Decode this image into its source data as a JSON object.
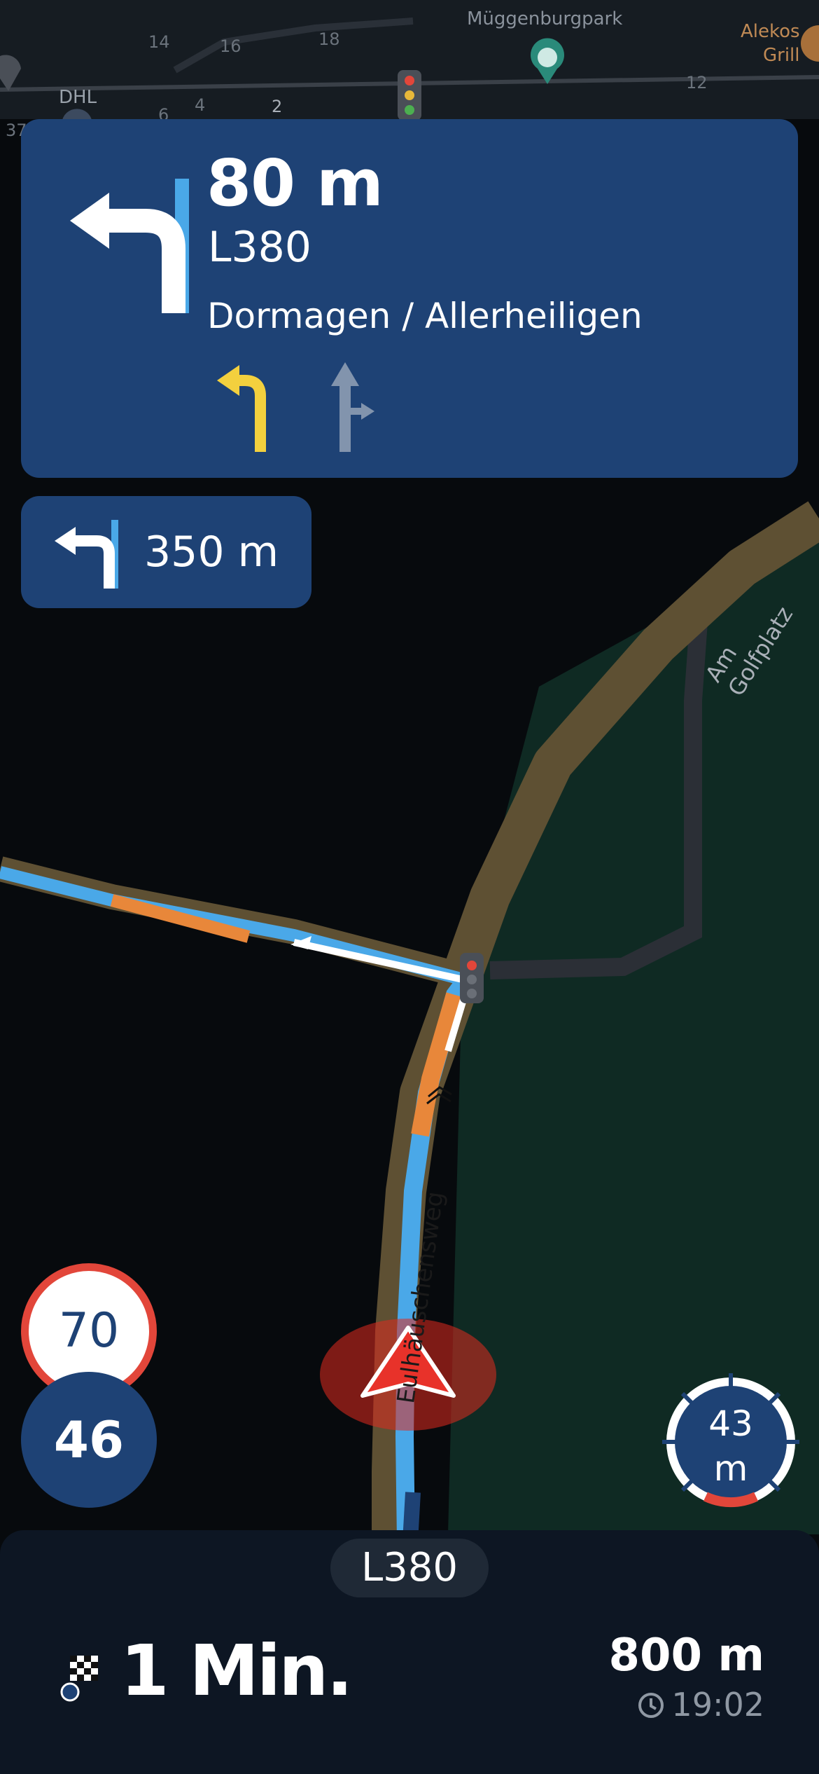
{
  "map": {
    "poi_park": "Müggenburgpark",
    "poi_restaurant_line1": "Alekos",
    "poi_restaurant_line2": "Grill",
    "poi_dhl": "DHL",
    "street_golfplatz": "Am Golfplatz",
    "street_current": "Eulhäuschensweg",
    "house_numbers": [
      "14",
      "16",
      "18",
      "4",
      "2",
      "6",
      "12",
      "37"
    ]
  },
  "maneuver": {
    "distance": "80 m",
    "road": "L380",
    "direction": "Dormagen / Allerheiligen",
    "arrow_icon": "turn-left-icon",
    "lanes": [
      {
        "icon": "lane-left-icon",
        "active": true
      },
      {
        "icon": "lane-straight-right-icon",
        "active": false
      }
    ]
  },
  "next_maneuver": {
    "distance": "350 m",
    "icon": "turn-left-icon"
  },
  "speed": {
    "limit": "70",
    "current": "46"
  },
  "gps_accuracy": {
    "value": "43",
    "unit": "m"
  },
  "bottom": {
    "current_road": "L380",
    "eta_duration": "1 Min.",
    "remaining_distance": "800 m",
    "arrival_time": "19:02"
  },
  "colors": {
    "panel_blue": "#1e4275",
    "route_blue": "#4aa8e8",
    "traffic_orange": "#e8873a",
    "road_brown": "#5e5033",
    "lane_active": "#f3d03e",
    "lane_inactive": "#8294ad",
    "speed_border": "#e2463a",
    "position_red": "#e02a1f"
  }
}
